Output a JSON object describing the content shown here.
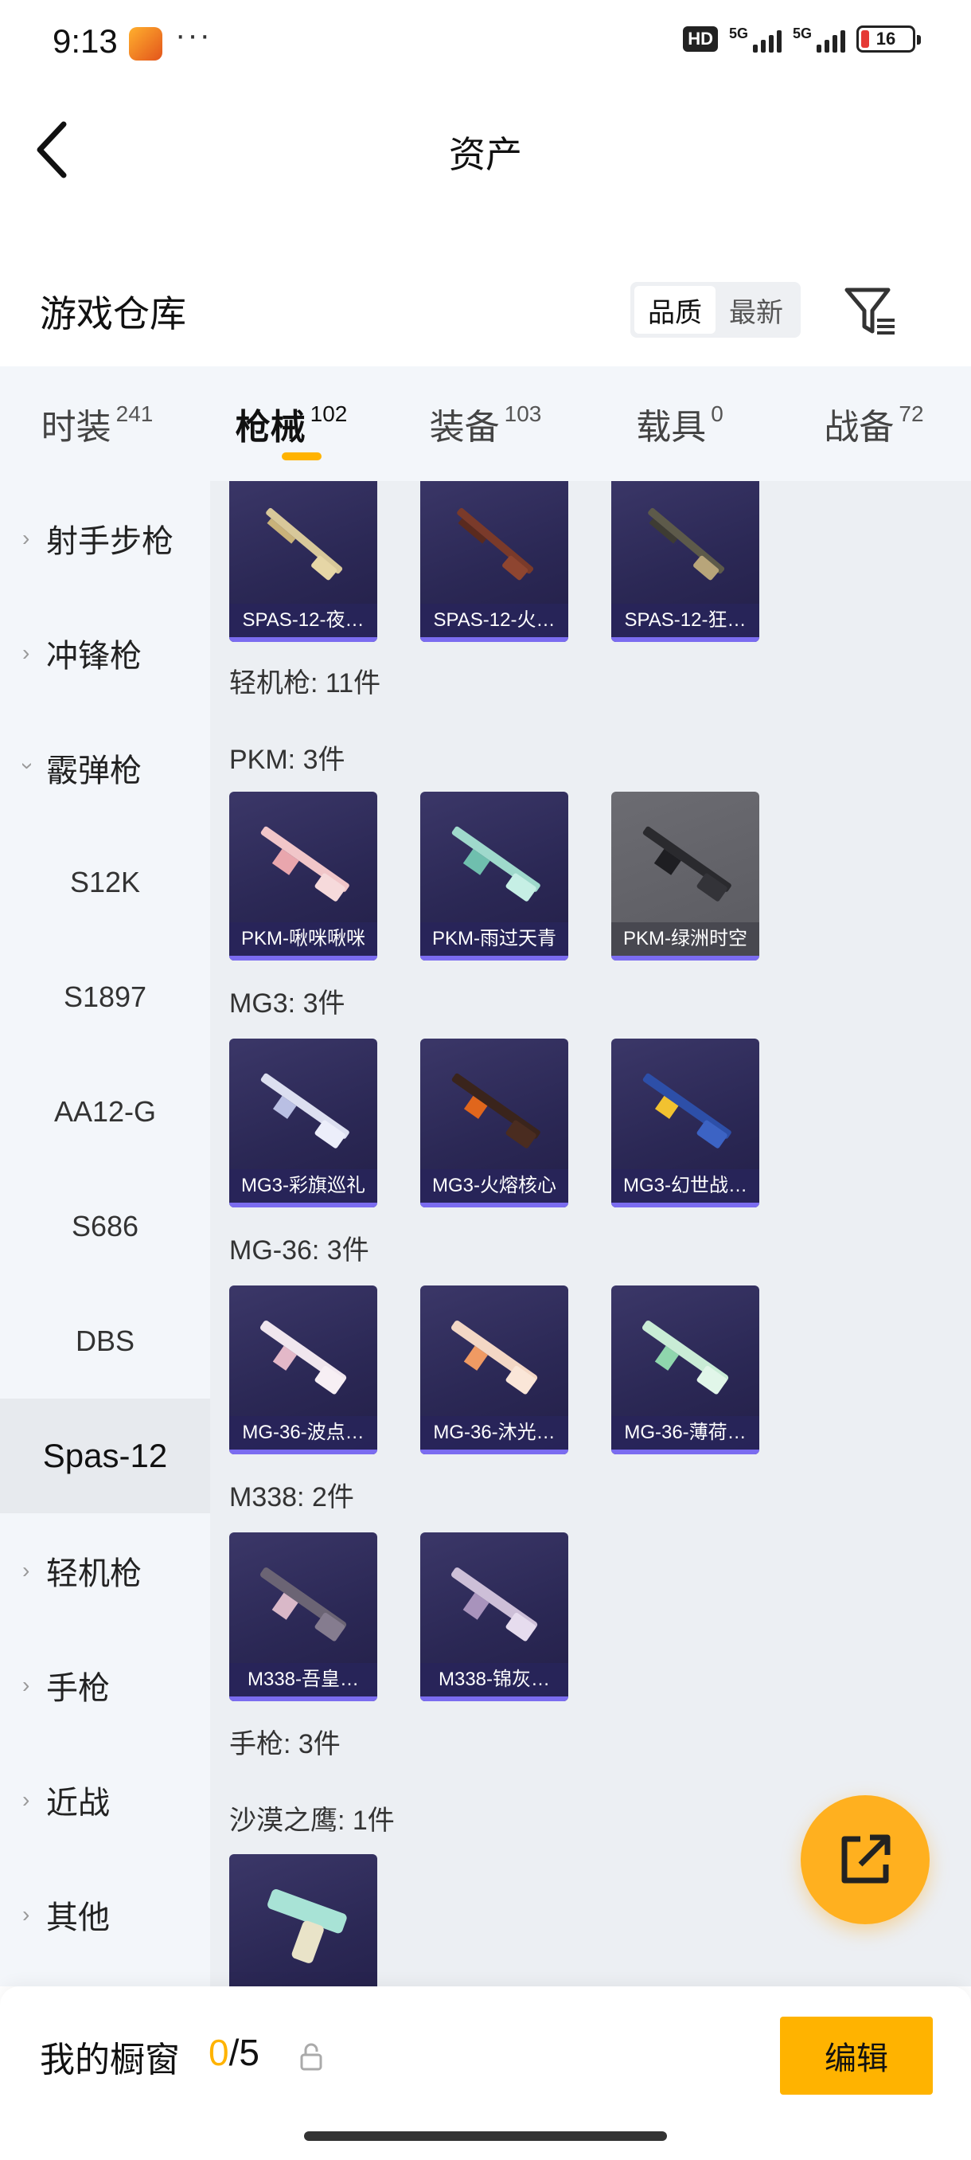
{
  "status_bar": {
    "time": "9:13",
    "more": "···",
    "hd": "HD",
    "net1": "5G",
    "net2": "5G",
    "battery": "16"
  },
  "header": {
    "title": "资产"
  },
  "warehouse": {
    "title": "游戏仓库",
    "sort_quality": "品质",
    "sort_newest": "最新"
  },
  "tabs": [
    {
      "label": "时装",
      "count": "241"
    },
    {
      "label": "枪械",
      "count": "102"
    },
    {
      "label": "装备",
      "count": "103"
    },
    {
      "label": "载具",
      "count": "0"
    },
    {
      "label": "战备",
      "count": "72"
    }
  ],
  "sidebar": [
    {
      "label": "射手步枪"
    },
    {
      "label": "冲锋枪"
    },
    {
      "label": "霰弹枪"
    },
    {
      "label": "S12K"
    },
    {
      "label": "S1897"
    },
    {
      "label": "AA12-G"
    },
    {
      "label": "S686"
    },
    {
      "label": "DBS"
    },
    {
      "label": "Spas-12"
    },
    {
      "label": "轻机枪"
    },
    {
      "label": "手枪"
    },
    {
      "label": "近战"
    },
    {
      "label": "其他"
    }
  ],
  "content": {
    "spas_row": [
      "SPAS-12-夜…",
      "SPAS-12-火…",
      "SPAS-12-狂…"
    ],
    "lmg_header": "轻机枪: 11件",
    "pkm_header": "PKM: 3件",
    "pkm": [
      "PKM-啾咪啾咪",
      "PKM-雨过天青",
      "PKM-绿洲时空"
    ],
    "mg3_header": "MG3: 3件",
    "mg3": [
      "MG3-彩旗巡礼",
      "MG3-火熔核心",
      "MG3-幻世战…"
    ],
    "mg36_header": "MG-36: 3件",
    "mg36": [
      "MG-36-波点…",
      "MG-36-沐光…",
      "MG-36-薄荷…"
    ],
    "m338_header": "M338: 2件",
    "m338": [
      "M338-吾皇…",
      "M338-锦灰…"
    ],
    "pistol_header": "手枪: 3件",
    "deagle_header": "沙漠之鹰: 1件"
  },
  "bottom": {
    "showcase_label": "我的橱窗",
    "count_num": "0",
    "count_total": "/5",
    "edit_label": "编辑"
  },
  "colors": {
    "accent": "#ffb300",
    "card_bg": "#2b2855",
    "card_border": "#7b6cf0"
  }
}
